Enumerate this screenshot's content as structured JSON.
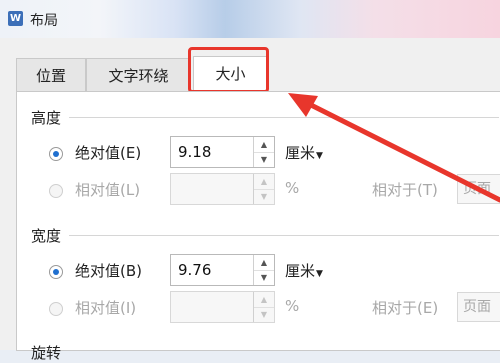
{
  "window": {
    "title": "布局",
    "app_icon_letter": "W"
  },
  "tabs": [
    {
      "label": "位置"
    },
    {
      "label": "文字环绕"
    },
    {
      "label": "大小"
    }
  ],
  "active_tab": "大小",
  "height_section": {
    "title": "高度",
    "absolute_label": "绝对值(E)",
    "absolute_value": "9.18",
    "absolute_unit": "厘米",
    "relative_label": "相对值(L)",
    "relative_value": "",
    "relative_unit": "%",
    "relative_to_label": "相对于(T)",
    "relative_to_value": "页面"
  },
  "width_section": {
    "title": "宽度",
    "absolute_label": "绝对值(B)",
    "absolute_value": "9.76",
    "absolute_unit": "厘米",
    "relative_label": "相对值(I)",
    "relative_value": "",
    "relative_unit": "%",
    "relative_to_label": "相对于(E)",
    "relative_to_value": "页面"
  },
  "partial_section_title": "旋转",
  "colors": {
    "highlight": "#e8362c",
    "radio_selected": "#1f6fcf"
  }
}
